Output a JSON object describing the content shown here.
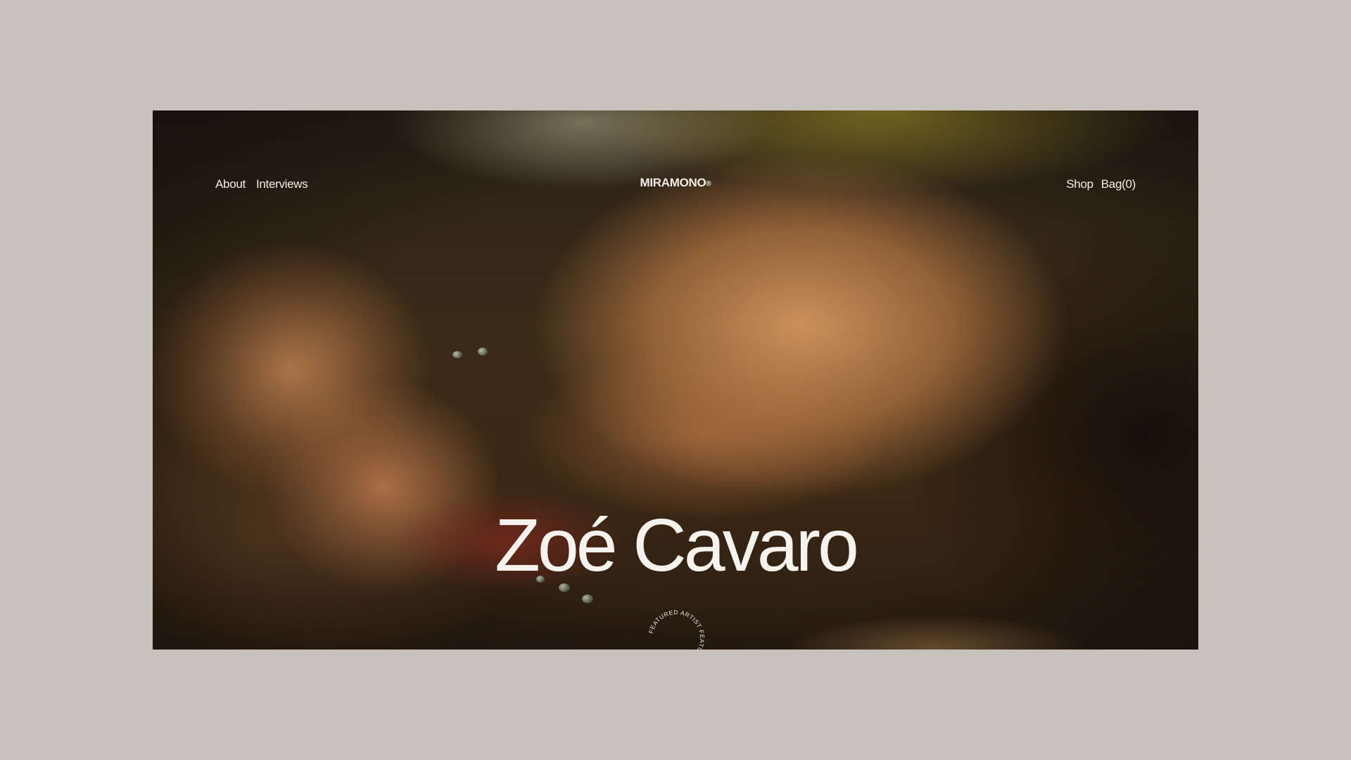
{
  "nav": {
    "left": [
      {
        "label": "About"
      },
      {
        "label": "Interviews"
      }
    ],
    "right": [
      {
        "label": "Shop"
      },
      {
        "label": "Bag(0)"
      }
    ]
  },
  "brand": {
    "name": "MIRAMONO",
    "mark": "®",
    "color": "#a7a9cf"
  },
  "hero": {
    "title": "Zoé Cavaro",
    "badge_text": "FEATURED ARTIST FEATURED ARTIST "
  },
  "colors": {
    "page_background": "#c6c1bb",
    "text": "#f6f3ee"
  }
}
